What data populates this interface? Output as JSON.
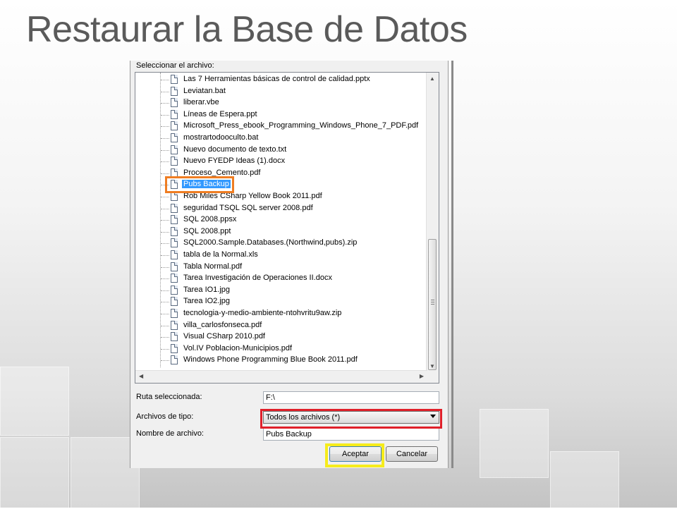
{
  "slide": {
    "title": "Restaurar la Base de Datos"
  },
  "dialog": {
    "select_label": "Seleccionar el archivo:",
    "files": [
      "Las 7 Herramientas básicas de control de calidad.pptx",
      "Leviatan.bat",
      "liberar.vbe",
      "Líneas de Espera.ppt",
      "Microsoft_Press_ebook_Programming_Windows_Phone_7_PDF.pdf",
      "mostrartodooculto.bat",
      "Nuevo documento de texto.txt",
      "Nuevo FYEDP Ideas (1).docx",
      "Proceso_Cemento.pdf",
      "Pubs Backup",
      "Rob Miles CSharp Yellow Book 2011.pdf",
      "seguridad TSQL SQL server 2008.pdf",
      "SQL 2008.ppsx",
      "SQL 2008.ppt",
      "SQL2000.Sample.Databases.(Northwind,pubs).zip",
      "tabla de la Normal.xls",
      "Tabla Normal.pdf",
      "Tarea Investigación de Operaciones II.docx",
      "Tarea IO1.jpg",
      "Tarea IO2.jpg",
      "tecnologia-y-medio-ambiente-ntohvritu9aw.zip",
      "villa_carlosfonseca.pdf",
      "Visual CSharp  2010.pdf",
      "Vol.IV Poblacion-Municipios.pdf",
      "Windows Phone Programming Blue Book 2011.pdf"
    ],
    "selected_file": "Pubs Backup",
    "selected_path_label": "Ruta seleccionada:",
    "selected_path_value": "F:\\",
    "file_type_label": "Archivos de tipo:",
    "file_type_value": "Todos los archivos (*)",
    "file_name_label": "Nombre de archivo:",
    "file_name_value": "Pubs Backup",
    "ok_label": "Aceptar",
    "cancel_label": "Cancelar"
  },
  "colors": {
    "highlight_file": "#ef7d22",
    "highlight_type": "#e0202a",
    "highlight_ok": "#f6ec1c",
    "selection": "#3399ff"
  }
}
